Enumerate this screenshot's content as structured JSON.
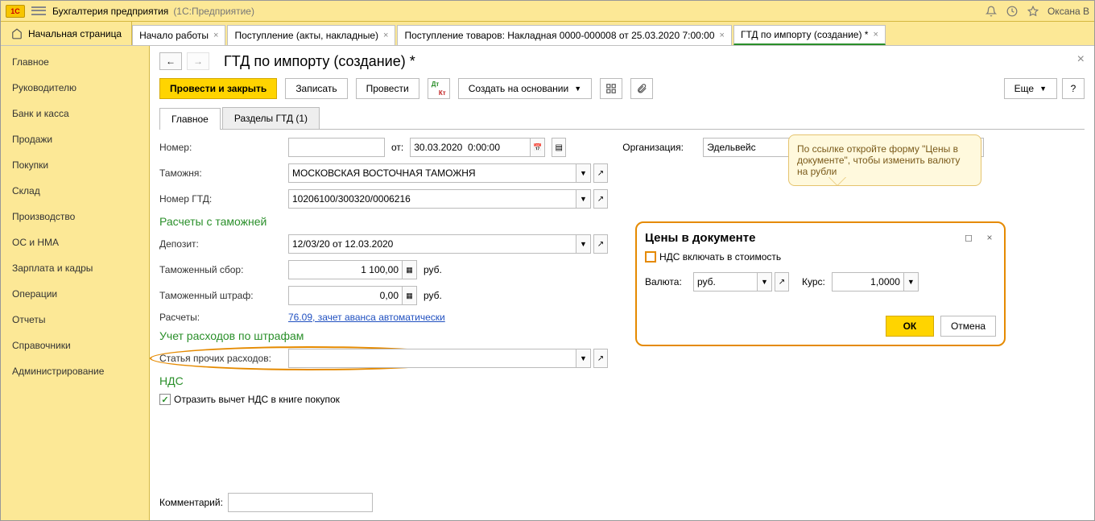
{
  "titlebar": {
    "app": "Бухгалтерия предприятия",
    "suffix": "(1С:Предприятие)",
    "user": "Оксана В"
  },
  "main_tabs": {
    "home": "Начальная страница",
    "items": [
      {
        "label": "Начало работы"
      },
      {
        "label": "Поступление (акты, накладные)"
      },
      {
        "label": "Поступление товаров: Накладная 0000-000008 от 25.03.2020 7:00:00"
      },
      {
        "label": "ГТД по импорту (создание) *",
        "active": true
      }
    ]
  },
  "sidebar": [
    "Главное",
    "Руководителю",
    "Банк и касса",
    "Продажи",
    "Покупки",
    "Склад",
    "Производство",
    "ОС и НМА",
    "Зарплата и кадры",
    "Операции",
    "Отчеты",
    "Справочники",
    "Администрирование"
  ],
  "page": {
    "title": "ГТД по импорту (создание) *"
  },
  "toolbar": {
    "submit": "Провести и закрыть",
    "save": "Записать",
    "post": "Провести",
    "create_based": "Создать на основании",
    "more": "Еще"
  },
  "form_tabs": {
    "main": "Главное",
    "sections": "Разделы ГТД (1)"
  },
  "form": {
    "number_lbl": "Номер:",
    "number": "",
    "from_lbl": "от:",
    "date": "30.03.2020  0:00:00",
    "org_lbl": "Организация:",
    "org": "Эдельвейс",
    "customs_lbl": "Таможня:",
    "customs": "МОСКОВСКАЯ ВОСТОЧНАЯ ТАМОЖНЯ",
    "currency_link": "Валюта: руб.",
    "gtd_no_lbl": "Номер ГТД:",
    "gtd_no": "10206100/300320/0006216",
    "section_calc": "Расчеты с таможней",
    "deposit_lbl": "Депозит:",
    "deposit": "12/03/20 от 12.03.2020",
    "fee_lbl": "Таможенный сбор:",
    "fee": "1 100,00",
    "fee_cur": "руб.",
    "fine_lbl": "Таможенный штраф:",
    "fine": "0,00",
    "fine_cur": "руб.",
    "calc_lbl": "Расчеты:",
    "calc_link": "76.09, зачет аванса автоматически",
    "section_fine": "Учет расходов по штрафам",
    "expense_lbl": "Статья прочих расходов:",
    "expense": "",
    "section_vat": "НДС",
    "vat_check": "Отразить вычет НДС в книге покупок",
    "comment_lbl": "Комментарий:",
    "comment": ""
  },
  "tooltip": "По ссылке откройте форму \"Цены в документе\", чтобы изменить валюту на рубли",
  "popup": {
    "title": "Цены в документе",
    "vat_in_cost": "НДС включать в стоимость",
    "currency_lbl": "Валюта:",
    "currency": "руб.",
    "rate_lbl": "Курс:",
    "rate": "1,0000",
    "ok": "ОК",
    "cancel": "Отмена"
  }
}
